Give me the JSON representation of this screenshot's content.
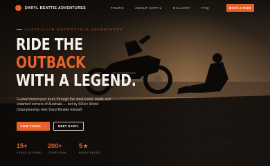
{
  "nav": {
    "brand": "DARYL BEATTIE ADVENTURES",
    "links": [
      "TOURS",
      "ABOUT DARYL",
      "GALLERY",
      "FAQ"
    ],
    "cta": "BOOK A RIDE"
  },
  "hero": {
    "eyebrow": "AUSTRALIAN MOTORCYCLE ADVENTURES",
    "headline_line1": "RIDE THE",
    "headline_line2": "OUTBACK",
    "headline_line3": "WITH A LEGEND.",
    "lede": "Guided motorcycle tours through the most iconic roads and untamed corners of Australia — led by 500cc World Championship rider Daryl Beattie himself.",
    "primary_button": "VIEW TOURS",
    "primary_arrow": "→",
    "secondary_button": "MEET DARYL"
  },
  "stats": [
    {
      "value": "15+",
      "label": "YEARS GUIDING"
    },
    {
      "value": "200+",
      "label": "TOURS RUN"
    },
    {
      "value": "5",
      "icon": "star-icon",
      "label": "RIDER RATED"
    }
  ],
  "colors": {
    "accent": "#e8612a",
    "background": "#0d0b09"
  }
}
